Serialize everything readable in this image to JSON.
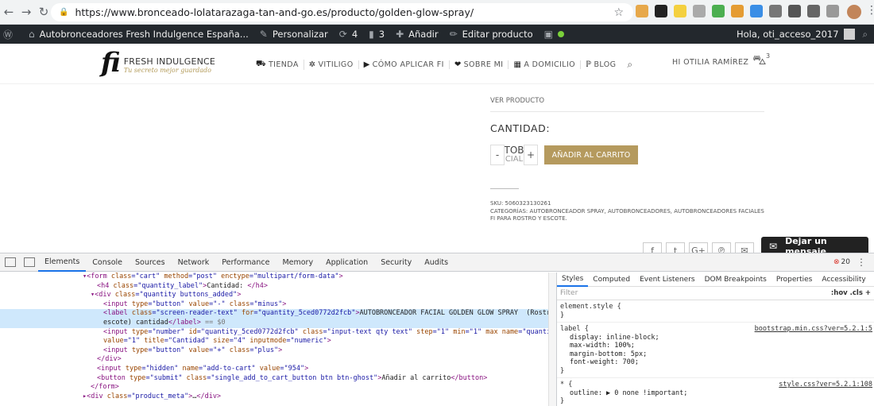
{
  "browser": {
    "url": "https://www.bronceado-lolatarazaga-tan-and-go.es/producto/golden-glow-spray/"
  },
  "adminbar": {
    "site_name": "Autobronceadores Fresh Indulgence España...",
    "customize": "Personalizar",
    "updates": "4",
    "comments": "3",
    "new": "Añadir",
    "edit": "Editar producto",
    "greeting": "Hola, oti_acceso_2017"
  },
  "header": {
    "logo_mark": "fi",
    "logo_brand": "FRESH INDULGENCE",
    "logo_tagline": "Tu secreto mejor guardado",
    "nav": [
      "TIENDA",
      "VITILIGO",
      "CÓMO APLICAR FI",
      "SOBRE MI",
      "A DOMICILIO",
      "BLOG"
    ],
    "user_greeting": "HI OTILIA RAMÍREZ",
    "cart_count": "3"
  },
  "product": {
    "ver_producto": "VER PRODUCTO",
    "cantidad_label": "CANTIDAD:",
    "qty_minus": "-",
    "qty_plus": "+",
    "qty_text_top": "TOB",
    "qty_text_bottom": "CIAL",
    "add_to_cart": "AÑADIR AL CARRITO",
    "sku": "SKU: 5060323130261",
    "categories_label": "CATEGORÍAS:",
    "categories": "AUTOBRONCEADOR SPRAY, AUTOBRONCEADORES, AUTOBRONCEADORES FACIALES FI PARA ROSTRO Y ESCOTE.",
    "chat_label": "Dejar un mensaje"
  },
  "devtools": {
    "tabs": [
      "Elements",
      "Console",
      "Sources",
      "Network",
      "Performance",
      "Memory",
      "Application",
      "Security",
      "Audits"
    ],
    "error_count": "20",
    "styles_tabs": [
      "Styles",
      "Computed",
      "Event Listeners",
      "DOM Breakpoints",
      "Properties",
      "Accessibility"
    ],
    "filter_placeholder": "Filter",
    "filter_options": ":hov  .cls  +",
    "element_style": "element.style {",
    "label_rule_selector": "label {",
    "label_rule_source": "bootstrap.min.css?ver=5.2.1:5",
    "label_props": [
      "display: inline-block;",
      "max-width: 100%;",
      "margin-bottom: 5px;",
      "font-weight: 700;"
    ],
    "star_rule_selector": "* {",
    "star_rule_source": "style.css?ver=5.2.1:108",
    "star_props": [
      "outline: ▶ 0 none !important;"
    ],
    "close_brace": "}"
  }
}
